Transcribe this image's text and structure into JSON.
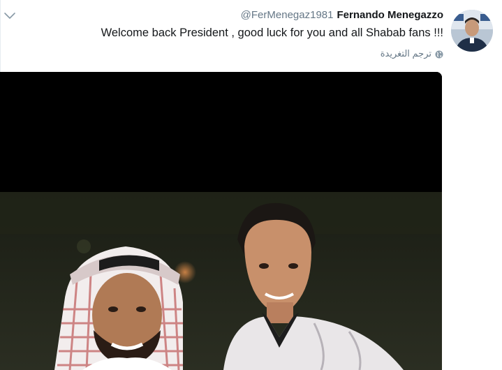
{
  "tweet": {
    "fullname": "Fernando Menegazzo",
    "handle": "@FerMenegaz1981",
    "text": "Welcome back President , good luck for you and all Shabab fans !!!",
    "translate_label": "ترجم التغريدة"
  },
  "icons": {
    "caret": "chevron-down-icon",
    "globe": "globe-icon",
    "avatar": "avatar"
  },
  "colors": {
    "text_primary": "#14171a",
    "text_secondary": "#657786",
    "caret": "#657786",
    "media_top": "#000000"
  }
}
